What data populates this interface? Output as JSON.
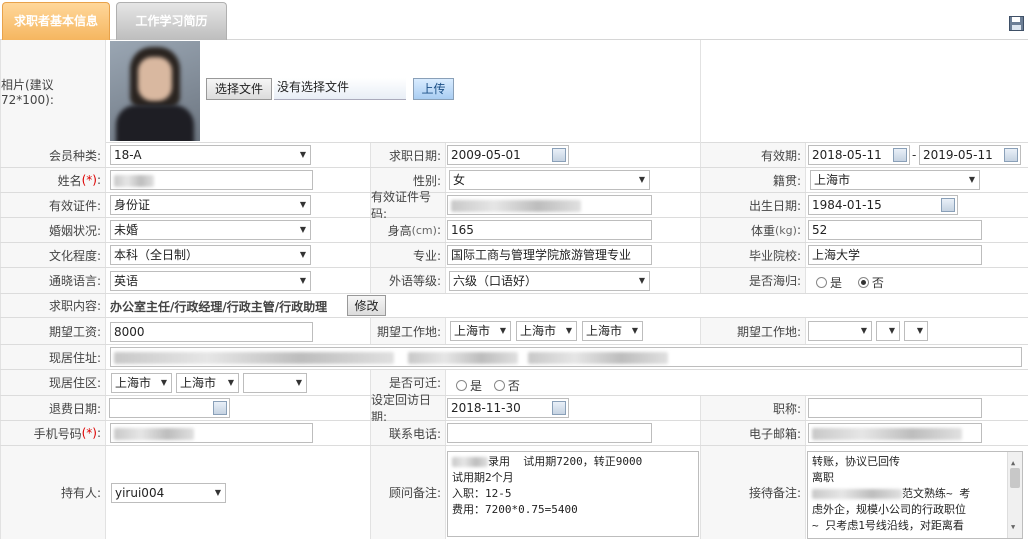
{
  "tabs": [
    {
      "label": "求职者基本信息",
      "active": true
    },
    {
      "label": "工作学习简历",
      "active": false
    }
  ],
  "icons": {
    "save": "floppy-disk-icon",
    "calendar": "calendar-icon"
  },
  "photo": {
    "label": "相片(建议72*100):",
    "choose_file_label": "选择文件",
    "no_file_text": "没有选择文件",
    "upload_label": "上传"
  },
  "form": {
    "member_type": {
      "label": "会员种类:",
      "value": "18-A"
    },
    "apply_date": {
      "label": "求职日期:",
      "value": "2009-05-01"
    },
    "valid_period": {
      "label": "有效期:",
      "start": "2018-05-11",
      "sep": "-",
      "end": "2019-05-11"
    },
    "name": {
      "label": "姓名",
      "req": "(*)",
      "colon": ":"
    },
    "gender": {
      "label": "性别:",
      "value": "女"
    },
    "native_place": {
      "label": "籍贯:",
      "value": "上海市"
    },
    "id_type": {
      "label": "有效证件:",
      "value": "身份证"
    },
    "id_number": {
      "label": "有效证件号码:"
    },
    "birth_date": {
      "label": "出生日期:",
      "value": "1984-01-15"
    },
    "marital": {
      "label": "婚姻状况:",
      "value": "未婚"
    },
    "height": {
      "label": "身高",
      "unit": "(cm)",
      "colon": ":",
      "value": "165"
    },
    "weight": {
      "label": "体重",
      "unit": "(kg)",
      "colon": ":",
      "value": "52"
    },
    "education": {
      "label": "文化程度:",
      "value": "本科（全日制）"
    },
    "major": {
      "label": "专业:",
      "value": "国际工商与管理学院旅游管理专业"
    },
    "school": {
      "label": "毕业院校:",
      "value": "上海大学"
    },
    "language": {
      "label": "通晓语言:",
      "value": "英语"
    },
    "lang_level": {
      "label": "外语等级:",
      "value": "六级（口语好）"
    },
    "returnee": {
      "label": "是否海归:",
      "yes": "是",
      "no": "否",
      "selected": "no"
    },
    "job_content": {
      "label": "求职内容:",
      "value": "办公室主任/行政经理/行政主管/行政助理",
      "edit_label": "修改"
    },
    "expected_salary": {
      "label": "期望工资:",
      "value": "8000"
    },
    "expected_loc1": {
      "label": "期望工作地:",
      "v1": "上海市",
      "v2": "上海市",
      "v3": "上海市"
    },
    "expected_loc2": {
      "label": "期望工作地:"
    },
    "address": {
      "label": "现居住址:"
    },
    "district": {
      "label": "现居住区:",
      "v1": "上海市",
      "v2": "上海市"
    },
    "relocate": {
      "label": "是否可迁:",
      "yes": "是",
      "no": "否"
    },
    "refund_date": {
      "label": "退费日期:"
    },
    "callback_date": {
      "label": "设定回访日期:",
      "value": "2018-11-30"
    },
    "title": {
      "label": "职称:"
    },
    "mobile": {
      "label": "手机号码",
      "req": "(*)",
      "colon": ":"
    },
    "phone": {
      "label": "联系电话:"
    },
    "email": {
      "label": "电子邮箱:"
    },
    "holder": {
      "label": "持有人:",
      "value": "yirui004"
    },
    "consultant_note": {
      "label": "顾问备注:",
      "lines": [
        "录用  试用期7200，转正9000",
        "试用期2个月",
        "入职：12-5",
        "费用：7200*0.75=5400"
      ]
    },
    "reception_note": {
      "label": "接待备注:",
      "lines": [
        "转账，协议已回传",
        "离职",
        "范文熟练~ 考",
        "虑外企，规模小公司的行政职位",
        "~ 只考虑1号线沿线，对距离看"
      ]
    }
  }
}
